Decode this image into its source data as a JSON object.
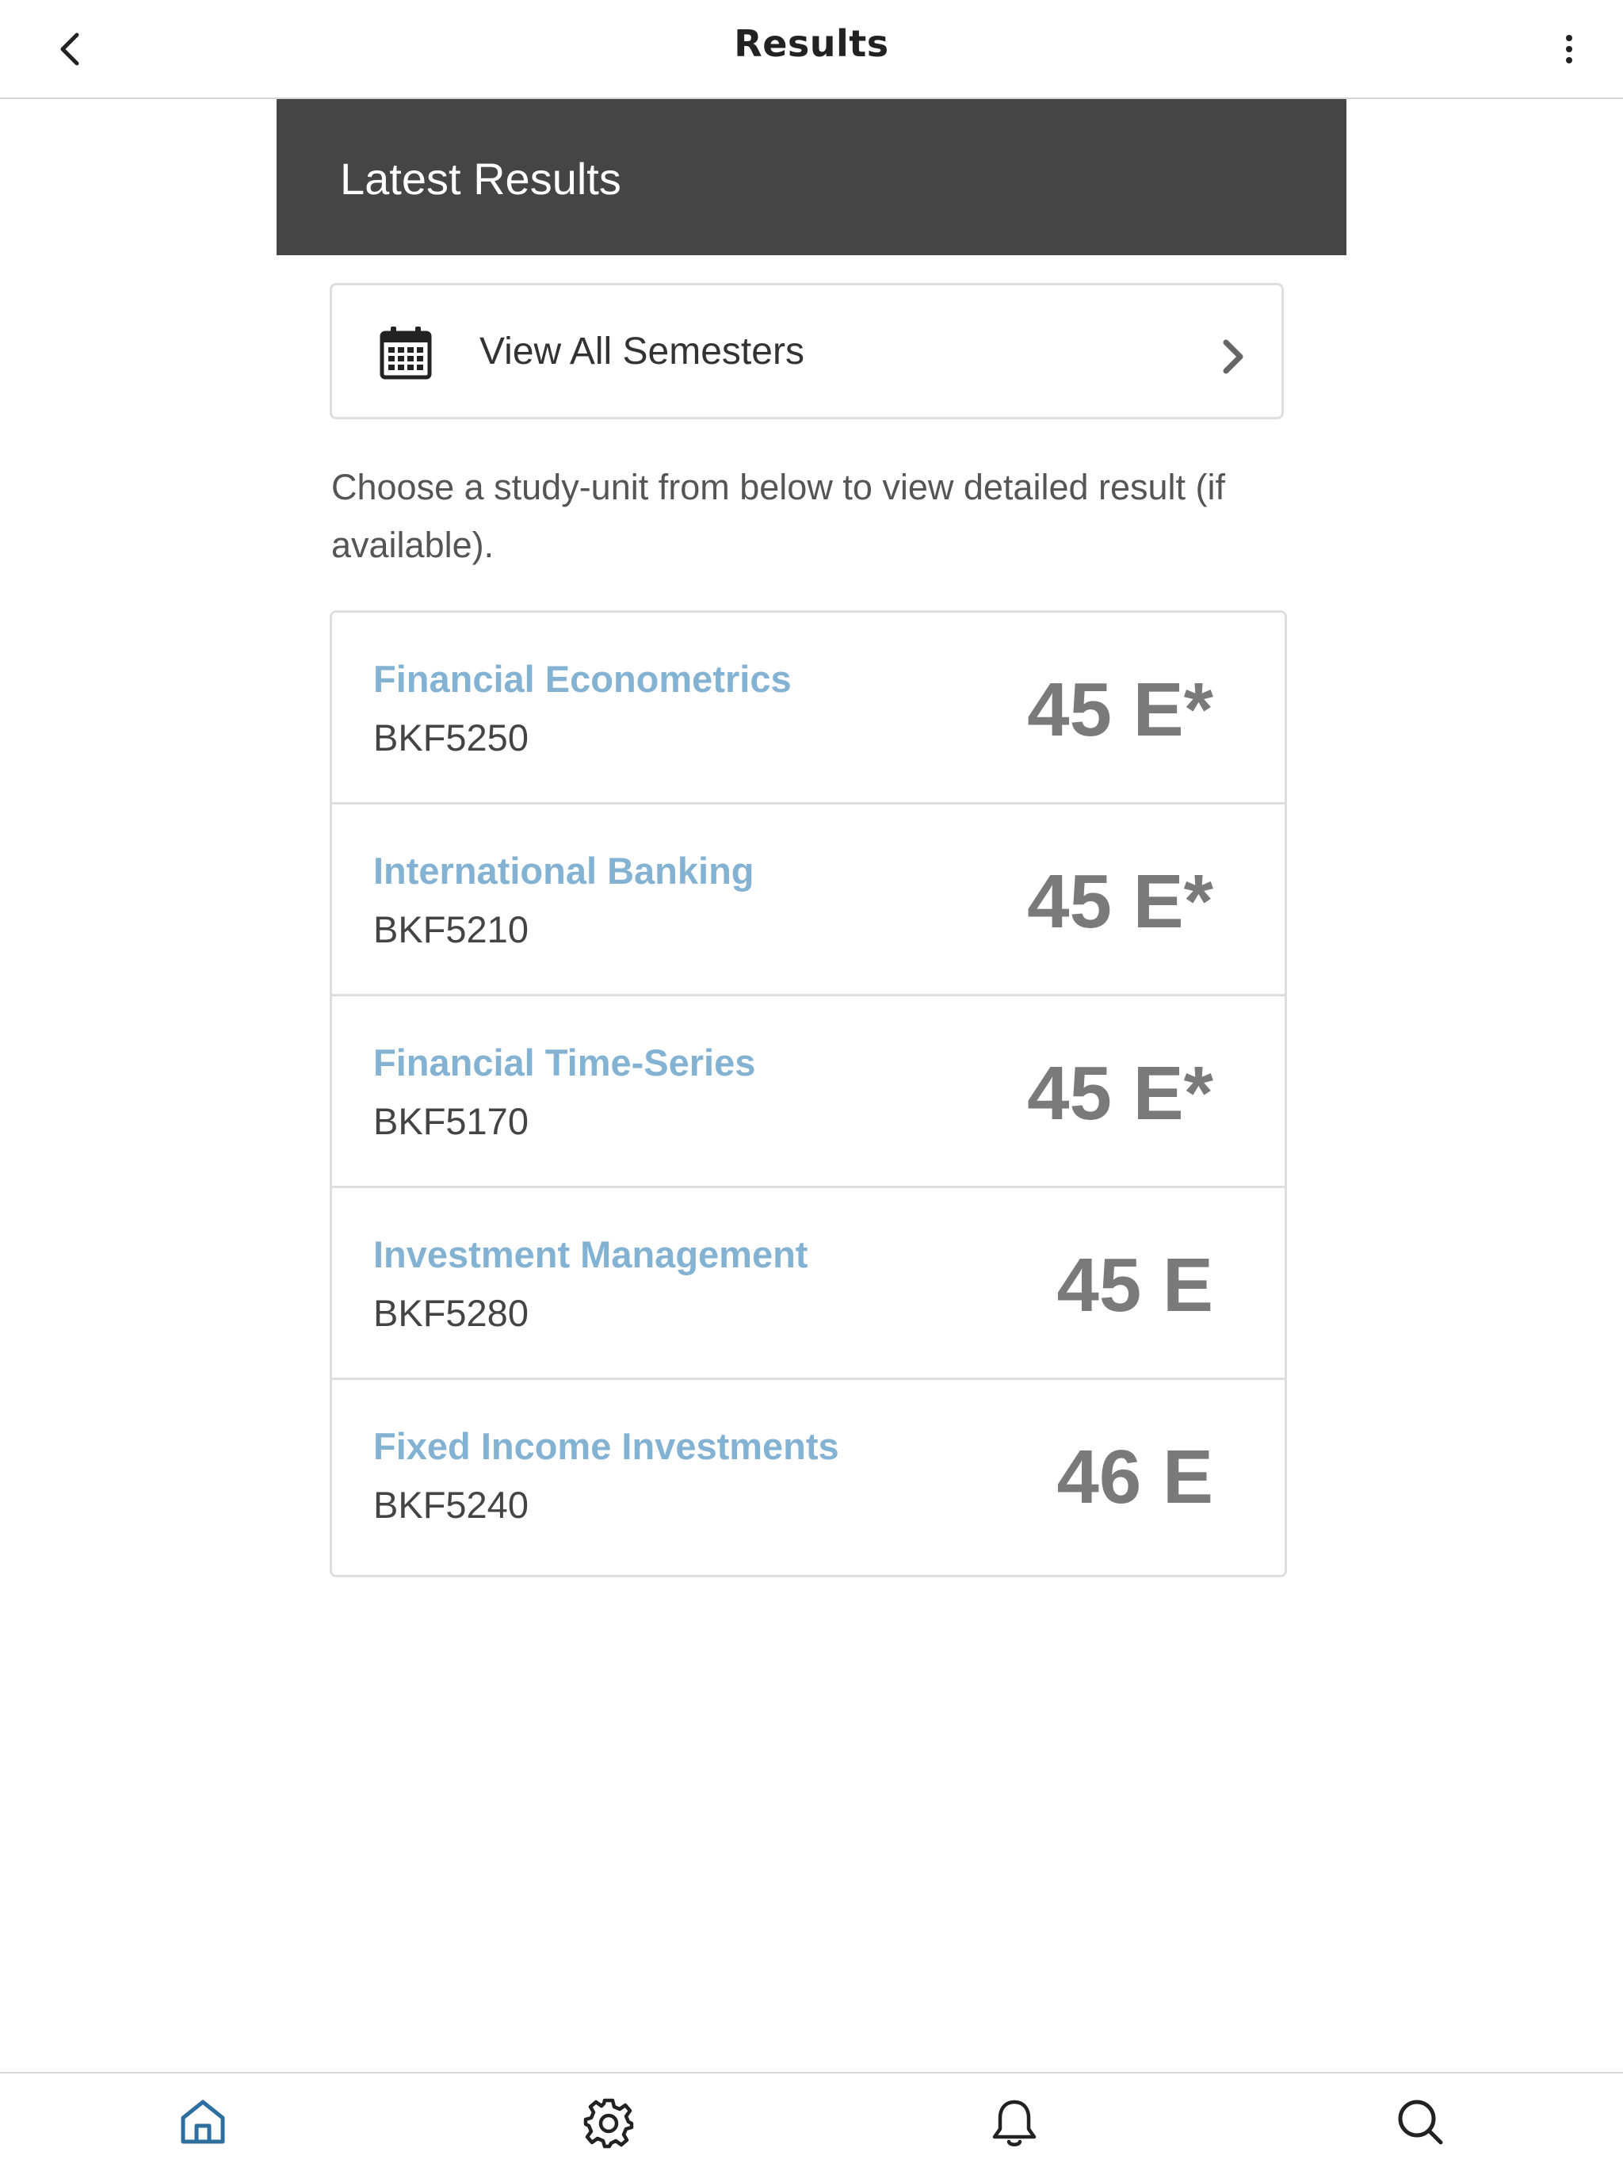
{
  "header": {
    "title": "Results"
  },
  "banner": {
    "title": "Latest Results"
  },
  "semesters": {
    "label": "View All Semesters"
  },
  "instruction": "Choose a study-unit from below to view detailed result (if available).",
  "results": [
    {
      "name": "Financial Econometrics",
      "code": "BKF5250",
      "grade": "45 E*"
    },
    {
      "name": "International Banking",
      "code": "BKF5210",
      "grade": "45 E*"
    },
    {
      "name": "Financial Time-Series",
      "code": "BKF5170",
      "grade": "45 E*"
    },
    {
      "name": "Investment Management",
      "code": "BKF5280",
      "grade": "45 E"
    },
    {
      "name": "Fixed Income Investments",
      "code": "BKF5240",
      "grade": "46 E"
    }
  ],
  "bottom_nav": [
    {
      "icon": "home-icon",
      "active": true
    },
    {
      "icon": "gear-icon",
      "active": false
    },
    {
      "icon": "bell-icon",
      "active": false
    },
    {
      "icon": "search-icon",
      "active": false
    }
  ],
  "colors": {
    "accent_link": "#83b2d3",
    "banner_bg": "#454545",
    "nav_active": "#2f6f9f",
    "grade_text": "#7a7a7a"
  }
}
